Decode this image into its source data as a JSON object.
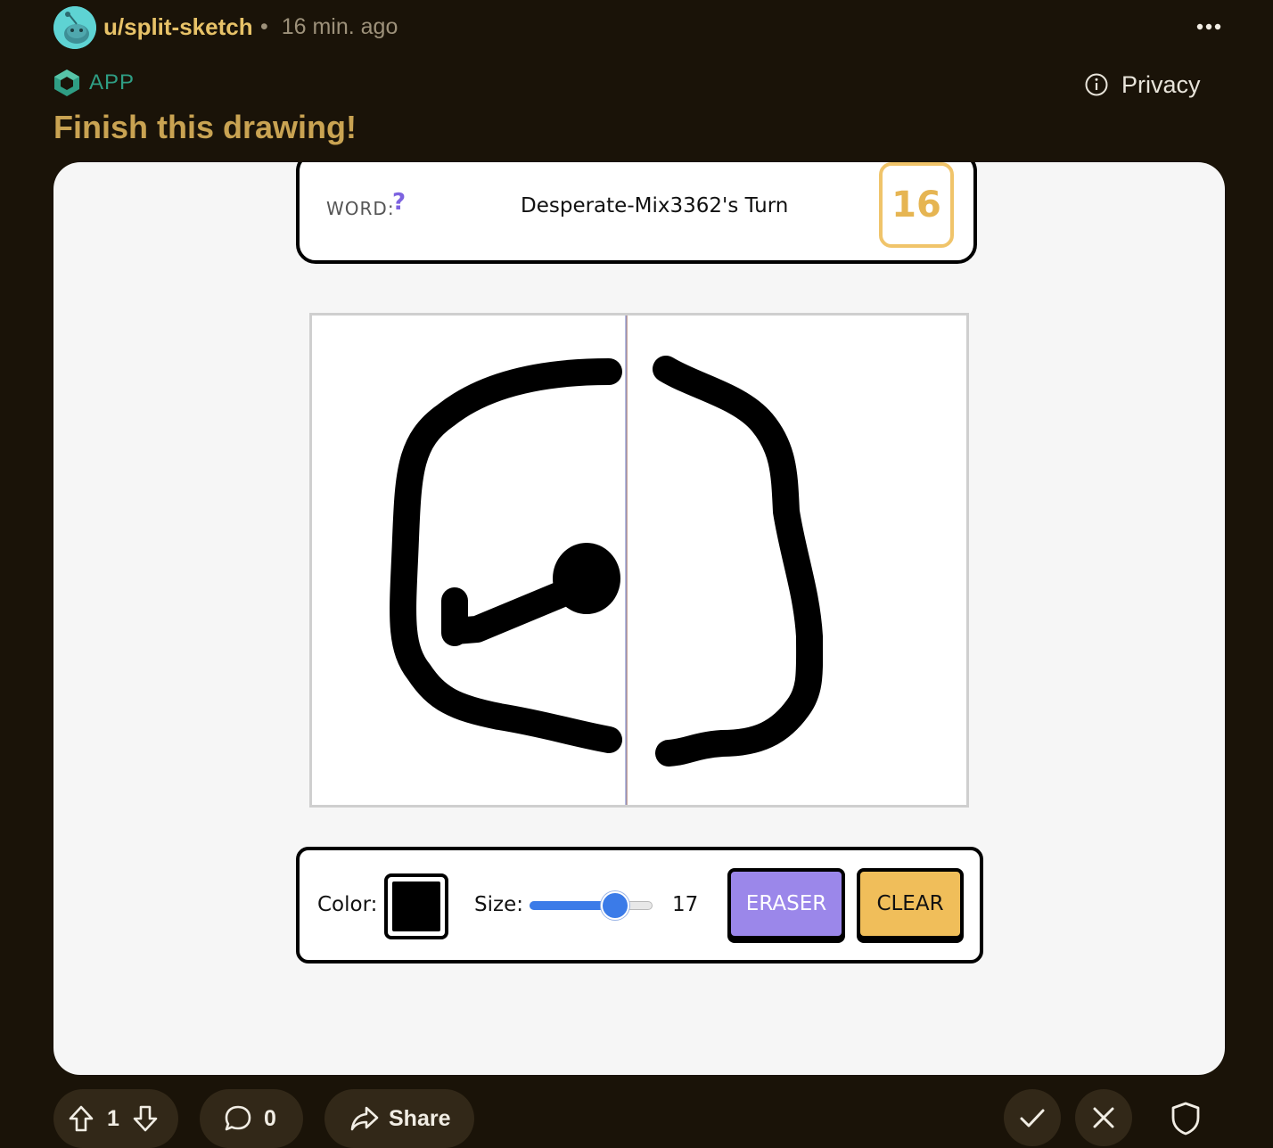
{
  "header": {
    "username": "u/split-sketch",
    "separator": "•",
    "time_ago": "16 min. ago",
    "more_icon": "more-horizontal-icon"
  },
  "app": {
    "label": "APP",
    "icon": "app-cube-icon",
    "privacy_label": "Privacy",
    "privacy_icon": "info-icon"
  },
  "post": {
    "title": "Finish this drawing!"
  },
  "game": {
    "word_label": "WORD:",
    "word_value": "?",
    "turn_text": "Desperate-Mix3362's Turn",
    "timer": "16"
  },
  "toolbar": {
    "color_label": "Color:",
    "color_value": "#000000",
    "size_label": "Size:",
    "size_value": "17",
    "size_fraction": 0.75,
    "eraser_label": "ERASER",
    "clear_label": "CLEAR"
  },
  "actions": {
    "upvotes": "1",
    "comments": "0",
    "share_label": "Share"
  },
  "colors": {
    "background": "#1a1308",
    "username": "#e7c268",
    "title": "#c9a352",
    "app_accent": "#2f9e84",
    "eraser": "#9b87ea",
    "clear": "#f0be5a",
    "timer": "#e6b552",
    "slider": "#3b7be8"
  }
}
